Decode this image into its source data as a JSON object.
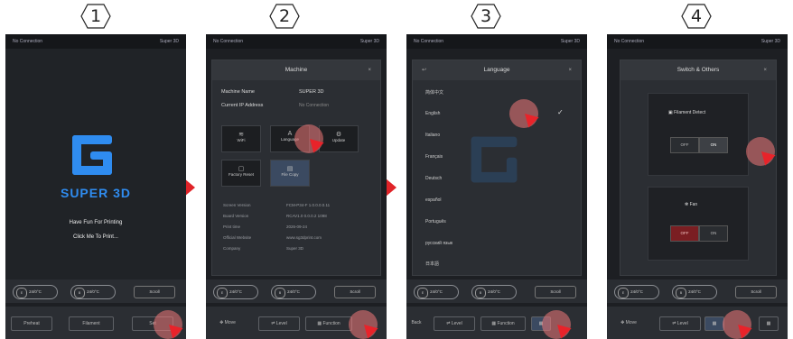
{
  "steps": [
    "1",
    "2",
    "3",
    "4"
  ],
  "status": {
    "left": "No Connection",
    "right": "Super 3D"
  },
  "screen1": {
    "brand": "SUPER 3D",
    "line1": "Have Fun For Printing",
    "line2": "Click Me To Print...",
    "temp1": "24/0°C",
    "temp2": "24/0°C",
    "scroll": "Scroll",
    "btn1": "Preheat",
    "btn2": "Filament",
    "btn3": "Set"
  },
  "screen2": {
    "title": "Machine",
    "close": "×",
    "machine_name_label": "Machine Name",
    "machine_name_value": "SUPER 3D",
    "ip_label": "Current IP Address",
    "ip_value": "No Connection",
    "tiles": [
      "WiFi",
      "Language",
      "Update",
      "Factory Reset",
      "File Copy"
    ],
    "info": [
      {
        "k": "Screen Version",
        "v": "FCM-P34-F 1.0.0.0.0.11"
      },
      {
        "k": "Board Version",
        "v": "RCAV1.0 0.0.0.2 1098"
      },
      {
        "k": "Print time",
        "v": "2026-09-24"
      },
      {
        "k": "Official Website",
        "v": "www.sg3dprint.com"
      },
      {
        "k": "Company",
        "v": "Super 3D"
      }
    ],
    "temp1": "24/0°C",
    "temp2": "24/0°C",
    "scroll": "Scroll",
    "btn1": "Move",
    "btn2": "Level",
    "btn3": "Function"
  },
  "screen3": {
    "title": "Language",
    "close": "×",
    "languages": [
      "简体中文",
      "English",
      "Italiano",
      "Français",
      "Deutsch",
      "español",
      "Português",
      "русский язык",
      "日本語"
    ],
    "check": "✓",
    "temp1": "24/0°C",
    "temp2": "24/0°C",
    "scroll": "Scroll",
    "btn0": "Back",
    "btn1": "Level",
    "btn2": "Function"
  },
  "screen4": {
    "title": "Switch & Others",
    "close": "×",
    "card1_title": "Filament Detect",
    "card1_off": "OFF",
    "card1_on": "ON",
    "card2_title": "Fan",
    "card2_off": "OFF",
    "card2_on": "ON",
    "temp1": "24/0°C",
    "temp2": "24/0°C",
    "scroll": "Scroll",
    "btn1": "Move",
    "btn2": "Level"
  },
  "colors": {
    "accent": "#2f8cf0",
    "arrow": "#e02328",
    "screen_bg": "#1d1f23"
  }
}
